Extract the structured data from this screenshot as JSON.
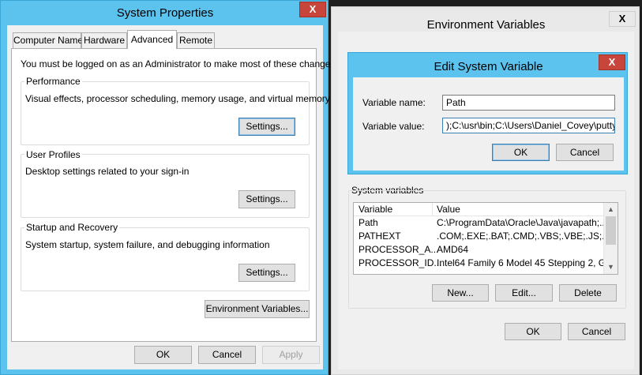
{
  "system_properties": {
    "title": "System Properties",
    "close": "X",
    "tabs": [
      "Computer Name",
      "Hardware",
      "Advanced",
      "Remote"
    ],
    "admin_note": "You must be logged on as an Administrator to make most of these changes.",
    "performance": {
      "title": "Performance",
      "desc": "Visual effects, processor scheduling, memory usage, and virtual memory",
      "button": "Settings..."
    },
    "user_profiles": {
      "title": "User Profiles",
      "desc": "Desktop settings related to your sign-in",
      "button": "Settings..."
    },
    "startup": {
      "title": "Startup and Recovery",
      "desc": "System startup, system failure, and debugging information",
      "button": "Settings..."
    },
    "env_button": "Environment Variables...",
    "ok": "OK",
    "cancel": "Cancel",
    "apply": "Apply"
  },
  "environment_variables": {
    "title": "Environment Variables",
    "close": "X",
    "system_vars_label": "System variables",
    "columns": [
      "Variable",
      "Value"
    ],
    "rows": [
      {
        "variable": "Path",
        "value": "C:\\ProgramData\\Oracle\\Java\\javapath;..."
      },
      {
        "variable": "PATHEXT",
        "value": ".COM;.EXE;.BAT;.CMD;.VBS;.VBE;.JS;...."
      },
      {
        "variable": "PROCESSOR_A...",
        "value": "AMD64"
      },
      {
        "variable": "PROCESSOR_ID...",
        "value": "Intel64 Family 6 Model 45 Stepping 2, G..."
      }
    ],
    "new": "New...",
    "edit": "Edit...",
    "delete": "Delete",
    "ok": "OK",
    "cancel": "Cancel"
  },
  "edit_variable": {
    "title": "Edit System Variable",
    "close": "X",
    "name_label": "Variable name:",
    "name_value": "Path",
    "value_label": "Variable value:",
    "value_value": ");C:\\usr\\bin;C:\\Users\\Daniel_Covey\\putty",
    "ok": "OK",
    "cancel": "Cancel"
  },
  "colors": {
    "frame": "#5bc3ee",
    "close": "#c7453a",
    "client": "#f0f0f0"
  }
}
